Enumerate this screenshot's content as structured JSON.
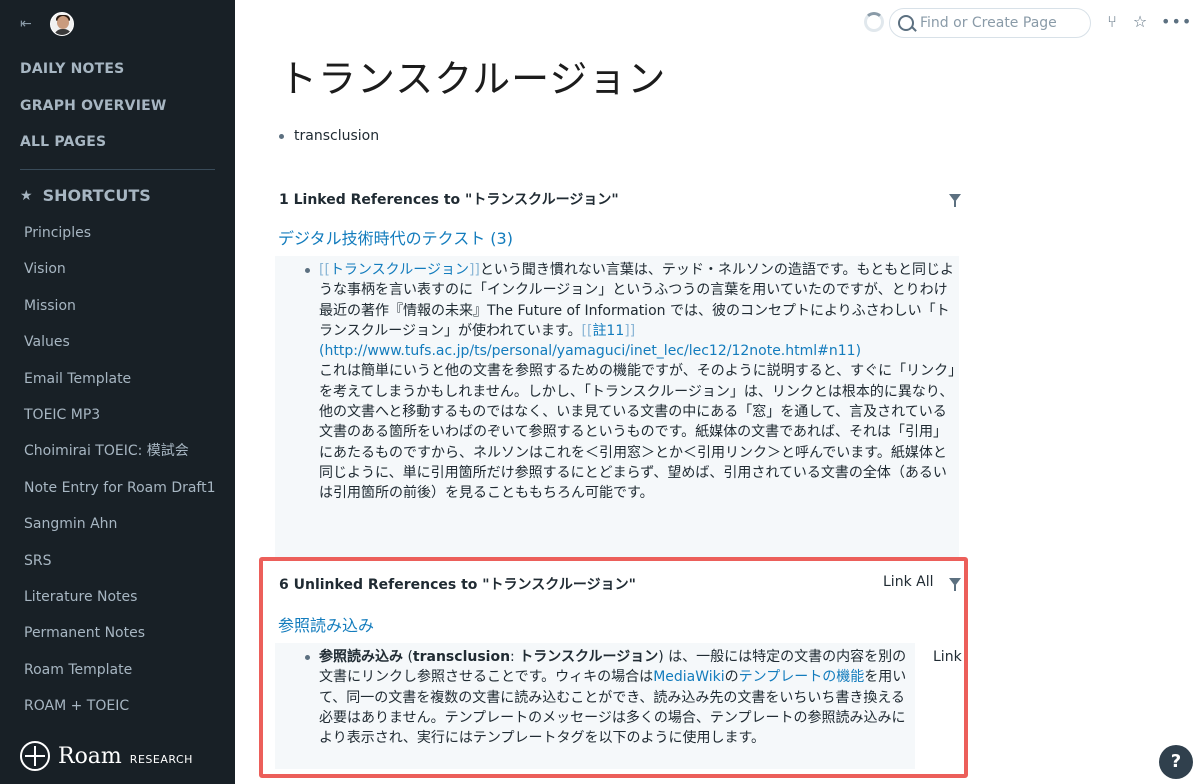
{
  "sidebar": {
    "nav": [
      "DAILY NOTES",
      "GRAPH OVERVIEW",
      "ALL PAGES"
    ],
    "shortcuts_title": "SHORTCUTS",
    "shortcuts": [
      "Principles",
      "Vision",
      "Mission",
      "Values",
      "Email Template",
      "TOEIC MP3",
      "Choimirai TOEIC: 模試会",
      "Note Entry for Roam Draft1",
      "Sangmin Ahn",
      "SRS",
      "Literature Notes",
      "Permanent Notes",
      "Roam Template",
      "ROAM + TOEIC"
    ],
    "brand_name": "Roam",
    "brand_sub": "RESEARCH"
  },
  "topbar": {
    "search_placeholder": "Find or Create Page"
  },
  "page": {
    "title": "トランスクルージョン",
    "block": "transclusion"
  },
  "linked": {
    "header": "1 Linked References to \"トランスクルージョン\"",
    "page_title": "デジタル技術時代のテクスト (3)",
    "bracket_open": "[[",
    "bracket_close": "]]",
    "link1": "トランスクルージョン",
    "text1": "という聞き慣れない言葉は、テッド・ネルソンの造語です。もともと同じような事柄を言い表すのに「インクルージョン」というふつうの言葉を用いていたのですが、とりわけ最近の著作『情報の未来』The Future of Information では、彼のコンセプトによりふさわしい「トランスクルージョン」が使われています。",
    "link2": "註11",
    "url": "(http://www.tufs.ac.jp/ts/personal/yamaguci/inet_lec/lec12/12note.html#n11)",
    "text2": "これは簡単にいうと他の文書を参照するための機能ですが、そのように説明すると、すぐに「リンク」を考えてしまうかもしれません。しかし、「トランスクルージョン」は、リンクとは根本的に異なり、他の文書へと移動するものではなく、いま見ている文書の中にある「窓」を通して、言及されている文書のある箇所をいわばのぞいて参照するというものです。紙媒体の文書であれば、それは「引用」にあたるものですから、ネルソンはこれを＜引用窓＞とか＜引用リンク＞と呼んでいます。紙媒体と同じように、単に引用箇所だけ参照するにとどまらず、望めば、引用されている文書の全体（あるいは引用箇所の前後）を見ることももちろん可能です。"
  },
  "unlinked": {
    "header": "6 Unlinked References to \"トランスクルージョン\"",
    "link_all": "Link All",
    "page_title": "参照読み込み",
    "bold1": "参照読み込み",
    "paren_open": " (",
    "bold2": "transclusion",
    "colon": ": ",
    "bold3": "トランスクルージョン",
    "text1": ") は、一般には特定の文書の内容を別の文書にリンクし参照させることです。ウィキの場合は",
    "link1": "MediaWiki",
    "text2": "の",
    "link2": "テンプレートの機能",
    "text3": "を用いて、同一の文書を複数の文書に読み込むことができ、読み込み先の文書をいちいち書き換える必要はありません。テンプレートのメッセージは多くの場合、テンプレートの参照読み込みにより表示され、実行にはテンプレートタグを以下のように使用します。",
    "link_label": "Link"
  },
  "help_label": "?"
}
